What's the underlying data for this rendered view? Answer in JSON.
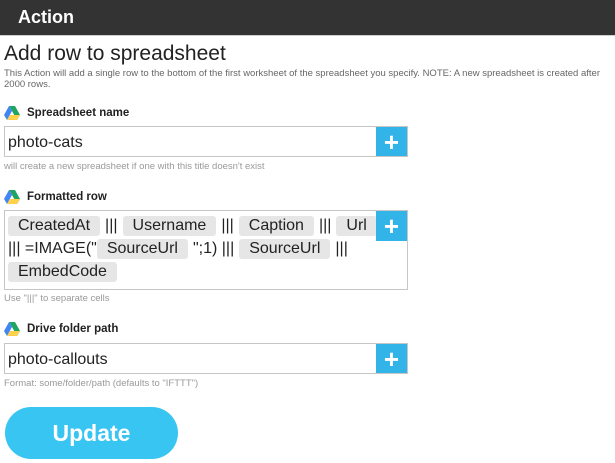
{
  "header": {
    "title": "Action"
  },
  "page": {
    "title": "Add row to spreadsheet",
    "description": "This Action will add a single row to the bottom of the first worksheet of the spreadsheet you specify. NOTE: A new spreadsheet is created after 2000 rows."
  },
  "fields": {
    "spreadsheet_name": {
      "label": "Spreadsheet name",
      "value": "photo-cats",
      "help": "will create a new spreadsheet if one with this title doesn't exist"
    },
    "formatted_row": {
      "label": "Formatted row",
      "tokens": [
        {
          "type": "pill",
          "text": "CreatedAt"
        },
        {
          "type": "text",
          "text": "|||"
        },
        {
          "type": "pill",
          "text": "Username"
        },
        {
          "type": "text",
          "text": "|||"
        },
        {
          "type": "pill",
          "text": "Caption"
        },
        {
          "type": "text",
          "text": "|||"
        },
        {
          "type": "pill",
          "text": "Url"
        },
        {
          "type": "text",
          "text": "||| =IMAGE(\""
        },
        {
          "type": "pill",
          "text": "SourceUrl"
        },
        {
          "type": "text",
          "text": "\";1) |||"
        },
        {
          "type": "pill",
          "text": "SourceUrl"
        },
        {
          "type": "text",
          "text": "|||"
        },
        {
          "type": "pill",
          "text": "EmbedCode"
        }
      ],
      "help": "Use \"|||\" to separate cells"
    },
    "drive_folder_path": {
      "label": "Drive folder path",
      "value": "photo-callouts",
      "help": "Format: some/folder/path (defaults to \"IFTTT\")"
    }
  },
  "plus_label": "+",
  "update_button": {
    "label": "Update",
    "color": "#39c5f2"
  },
  "colors": {
    "header_bg": "#333333",
    "accent": "#33b4e8",
    "pill_bg": "#e6e6e6"
  },
  "icons": {
    "drive": "google-drive-icon",
    "add": "plus-icon"
  }
}
